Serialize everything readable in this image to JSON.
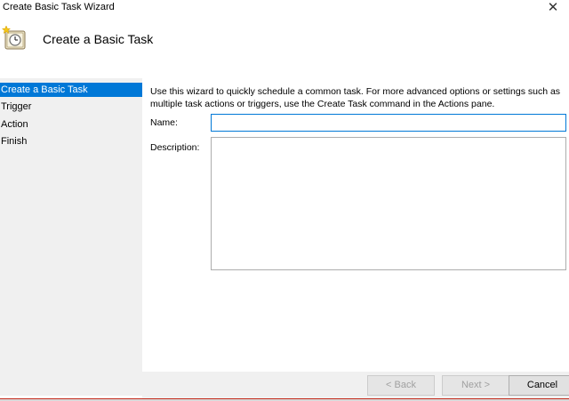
{
  "window": {
    "title": "Create Basic Task Wizard",
    "close_glyph": "✕"
  },
  "header": {
    "title": "Create a Basic Task",
    "icon": "task-scheduler-clock-icon"
  },
  "nav": {
    "items": [
      {
        "label": "Create a Basic Task",
        "active": true
      },
      {
        "label": "Trigger",
        "active": false
      },
      {
        "label": "Action",
        "active": false
      },
      {
        "label": "Finish",
        "active": false
      }
    ]
  },
  "main": {
    "intro": "Use this wizard to quickly schedule a common task.  For more advanced options or settings such as multiple task actions or triggers, use the Create Task command in the Actions pane.",
    "name_label": "Name:",
    "name_value": "",
    "description_label": "Description:",
    "description_value": ""
  },
  "footer": {
    "back_label": "< Back",
    "next_label": "Next >",
    "cancel_label": "Cancel"
  },
  "colors": {
    "accent": "#0078d7",
    "nav_bg": "#f0f0f0"
  }
}
